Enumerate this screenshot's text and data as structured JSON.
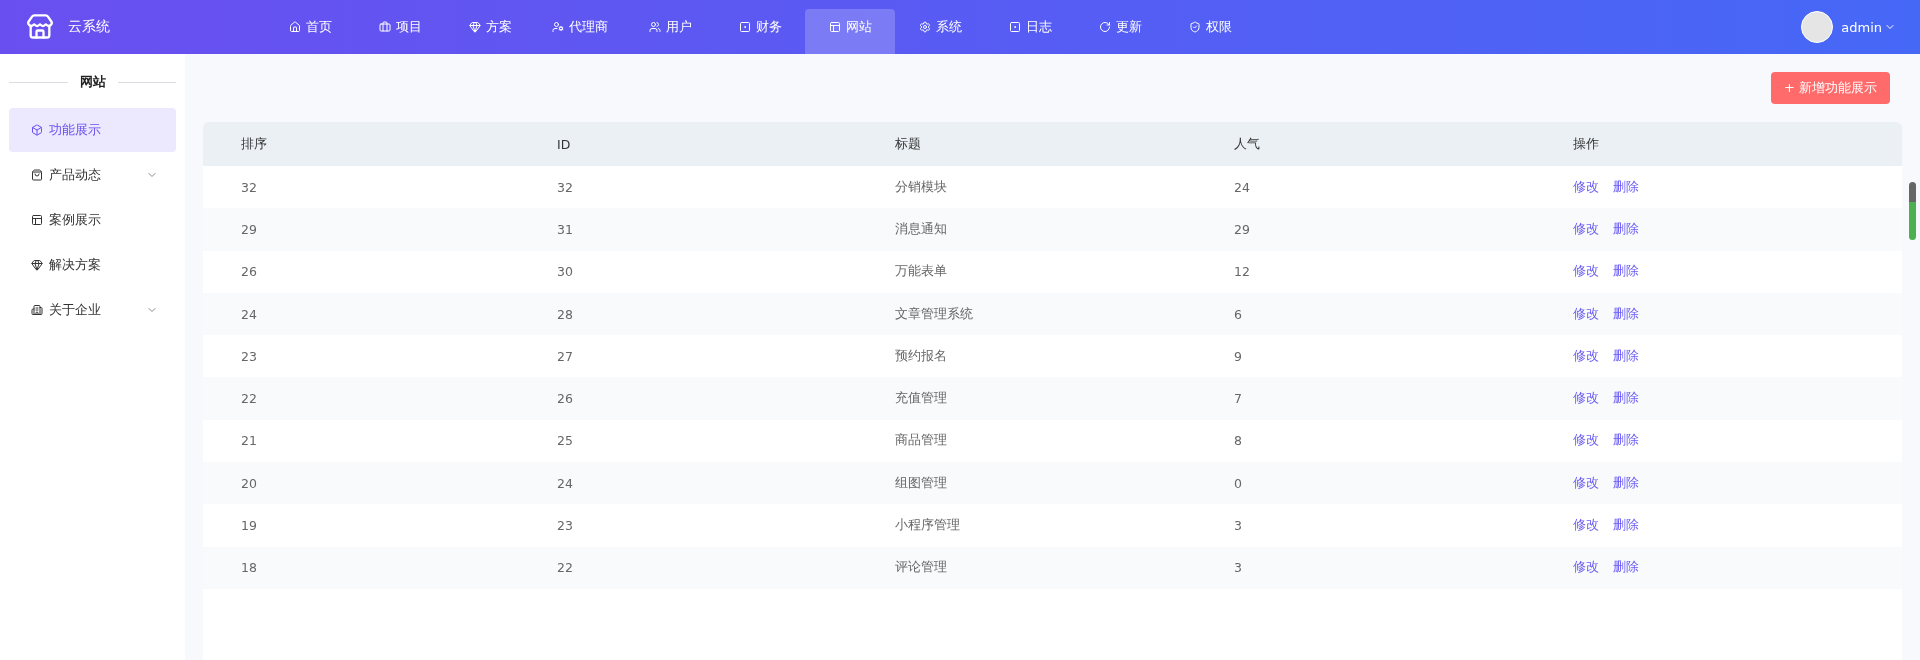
{
  "brand": {
    "name": "云系统"
  },
  "nav": [
    {
      "label": "首页",
      "selected": false
    },
    {
      "label": "项目",
      "selected": false
    },
    {
      "label": "方案",
      "selected": false
    },
    {
      "label": "代理商",
      "selected": false
    },
    {
      "label": "用户",
      "selected": false
    },
    {
      "label": "财务",
      "selected": false
    },
    {
      "label": "网站",
      "selected": true
    },
    {
      "label": "系统",
      "selected": false
    },
    {
      "label": "日志",
      "selected": false
    },
    {
      "label": "更新",
      "selected": false
    },
    {
      "label": "权限",
      "selected": false
    }
  ],
  "user": {
    "name": "admin"
  },
  "sidebar": {
    "title": "网站",
    "items": [
      {
        "label": "功能展示",
        "selected": true,
        "expandable": false
      },
      {
        "label": "产品动态",
        "selected": false,
        "expandable": true
      },
      {
        "label": "案例展示",
        "selected": false,
        "expandable": false
      },
      {
        "label": "解决方案",
        "selected": false,
        "expandable": false
      },
      {
        "label": "关于企业",
        "selected": false,
        "expandable": true
      }
    ]
  },
  "add_button": "+ 新增功能展示",
  "table": {
    "columns": [
      "排序",
      "ID",
      "标题",
      "人气",
      "操作"
    ],
    "rows": [
      {
        "order": "32",
        "id": "32",
        "title": "分销模块",
        "views": "24",
        "actions": [
          "修改",
          "删除"
        ]
      },
      {
        "order": "29",
        "id": "31",
        "title": "消息通知",
        "views": "29",
        "actions": [
          "修改",
          "删除"
        ]
      },
      {
        "order": "26",
        "id": "30",
        "title": "万能表单",
        "views": "12",
        "actions": [
          "修改",
          "删除"
        ]
      },
      {
        "order": "24",
        "id": "28",
        "title": "文章管理系统",
        "views": "6",
        "actions": [
          "修改",
          "删除"
        ]
      },
      {
        "order": "23",
        "id": "27",
        "title": "预约报名",
        "views": "9",
        "actions": [
          "修改",
          "删除"
        ]
      },
      {
        "order": "22",
        "id": "26",
        "title": "充值管理",
        "views": "7",
        "actions": [
          "修改",
          "删除"
        ]
      },
      {
        "order": "21",
        "id": "25",
        "title": "商品管理",
        "views": "8",
        "actions": [
          "修改",
          "删除"
        ]
      },
      {
        "order": "20",
        "id": "24",
        "title": "组图管理",
        "views": "0",
        "actions": [
          "修改",
          "删除"
        ]
      },
      {
        "order": "19",
        "id": "23",
        "title": "小程序管理",
        "views": "3",
        "actions": [
          "修改",
          "删除"
        ]
      },
      {
        "order": "18",
        "id": "22",
        "title": "评论管理",
        "views": "3",
        "actions": [
          "修改",
          "删除"
        ]
      }
    ]
  }
}
